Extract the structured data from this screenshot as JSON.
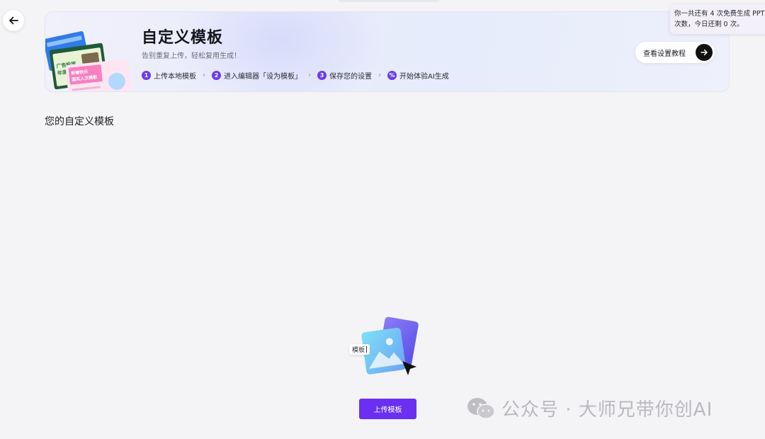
{
  "header": {
    "back_icon": "arrow-left-icon"
  },
  "banner": {
    "title": "自定义模板",
    "subtitle": "告别重复上传，轻松复用生成！",
    "steps": [
      {
        "num": "1",
        "label": "上传本地模板"
      },
      {
        "num": "2",
        "label": "进入编辑器「设为模板」"
      },
      {
        "num": "3",
        "label": "保存您的设置"
      },
      {
        "num": "%",
        "label": "开始体验AI生成"
      }
    ],
    "step_separator": "›",
    "tutorial_button_label": "查看设置教程",
    "illus_texts": {
      "card1_title": "广告投放",
      "card1_sub": "年度总结",
      "card2_title": "新春快乐",
      "card2_sub": "国风人文模板"
    }
  },
  "tooltip": {
    "line1": "你一共还有 4 次免费生成 PPT",
    "line2": "次数，今日还剩 0 次。"
  },
  "main": {
    "section_title": "您的自定义模板",
    "empty_label": "模板",
    "upload_button_label": "上传模板"
  },
  "watermark": {
    "text": "公众号 · 大师兄带你创AI"
  },
  "colors": {
    "accent": "#6a2ff0",
    "step_badge": "#6a3cf0",
    "background": "#f4f4f6"
  }
}
